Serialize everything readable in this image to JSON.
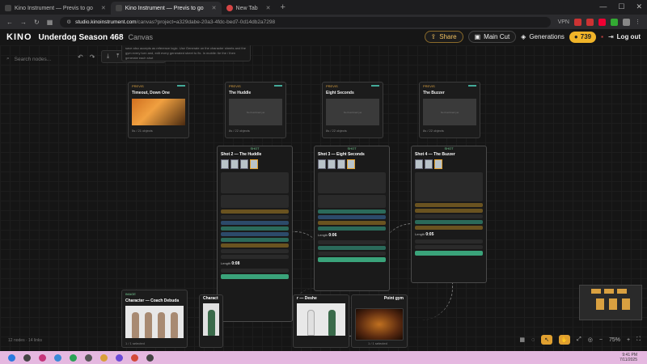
{
  "browser": {
    "tabs": [
      {
        "title": "Kino Instrument — Previs to go",
        "active": false
      },
      {
        "title": "Kino Instrument — Previs to go",
        "active": true
      },
      {
        "title": "New Tab",
        "active": false
      }
    ],
    "new_tab": "+",
    "url_host": "studio.kinoinstrument.com",
    "url_path": "/canvas?project=a329dabe-20a3-4fdc-bed7-0d14db2a7298",
    "vpn_label": "VPN"
  },
  "header": {
    "logo": "KINO",
    "project_title": "Underdog Season 468",
    "crumb": "Canvas",
    "share": "Share",
    "main_cut": "Main Cut",
    "generations": "Generations",
    "credits": "739",
    "logout": "Log out"
  },
  "canvas": {
    "search_placeholder": "Search nodes...",
    "tooltip": "save also accepts as reference logic. Use Generate on the character sheets and the gym every turn and, edit every generated sheet to fix. In mobile: tie the / then generate each shot",
    "scenes": [
      {
        "badge": "PREVIS",
        "title": "Timeout, Down One",
        "footer": "5s / 21 objects",
        "thumb": ""
      },
      {
        "badge": "PREVIS",
        "title": "The Huddle",
        "footer": "8s / 22 objects",
        "thumb": "No thumbnail yet"
      },
      {
        "badge": "PREVIS",
        "title": "Eight Seconds",
        "footer": "8s / 22 objects",
        "thumb": "No thumbnail yet"
      },
      {
        "badge": "PREVIS",
        "title": "The Buzzer",
        "footer": "8s / 22 objects",
        "thumb": "No thumbnail yet"
      }
    ],
    "shots": [
      {
        "badge": "SHOT",
        "title": "Shot 2 — The Huddle",
        "length_label": "Length",
        "length": "0:08"
      },
      {
        "badge": "SHOT",
        "title": "Shot 3 — Eight Seconds",
        "length_label": "Length",
        "length": "0:06"
      },
      {
        "badge": "SHOT",
        "title": "Shot 4 — The Buzzer",
        "length_label": "Length",
        "length": "0:05"
      }
    ],
    "characters": [
      {
        "badge": "IMAGE",
        "title": "Character — Coach Debuda",
        "footer": "1 / 1 selected"
      },
      {
        "badge": "IMAGE",
        "title": "Charact",
        "footer": ""
      },
      {
        "badge": "IMAGE",
        "title": "r — Deshe",
        "footer": ""
      },
      {
        "badge": "",
        "title": "Point gym",
        "footer": "1 / 1 selected"
      }
    ],
    "status": "12 nodes · 14 links",
    "zoom": "75%"
  },
  "taskbar": {
    "time": "9:41 PM",
    "date": "7/11/2025"
  }
}
